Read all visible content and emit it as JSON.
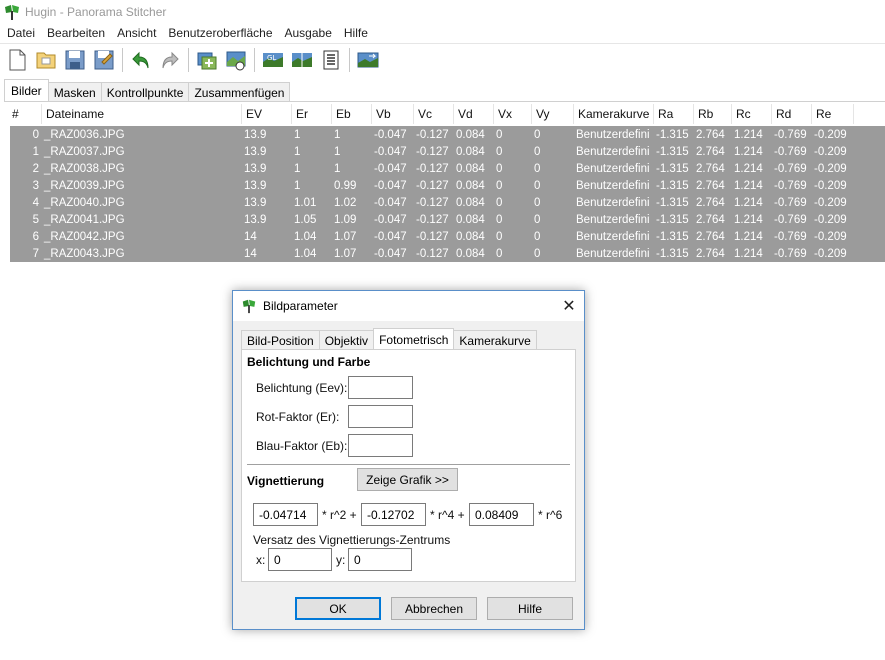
{
  "window": {
    "title": "Hugin - Panorama Stitcher"
  },
  "menu": [
    "Datei",
    "Bearbeiten",
    "Ansicht",
    "Benutzeroberfläche",
    "Ausgabe",
    "Hilfe"
  ],
  "toolbar": [
    "new-icon",
    "open-icon",
    "save-icon",
    "save-as-icon",
    "undo-icon",
    "redo-icon",
    "add-images-icon",
    "add-time-series-icon",
    "gl-preview-icon",
    "fast-preview-icon",
    "control-points-icon",
    "optimize-icon"
  ],
  "tabs": [
    "Bilder",
    "Masken",
    "Kontrollpunkte",
    "Zusammenfügen"
  ],
  "table": {
    "headers": [
      "#",
      "Dateiname",
      "EV",
      "Er",
      "Eb",
      "Vb",
      "Vc",
      "Vd",
      "Vx",
      "Vy",
      "Kamerakurve",
      "Ra",
      "Rb",
      "Rc",
      "Rd",
      "Re"
    ],
    "rows": [
      [
        "0",
        "_RAZ0036.JPG",
        "13.9",
        "1",
        "1",
        "-0.047",
        "-0.127",
        "0.084",
        "0",
        "0",
        "Benutzerdefini",
        "-1.315",
        "2.764",
        "1.214",
        "-0.769",
        "-0.209"
      ],
      [
        "1",
        "_RAZ0037.JPG",
        "13.9",
        "1",
        "1",
        "-0.047",
        "-0.127",
        "0.084",
        "0",
        "0",
        "Benutzerdefini",
        "-1.315",
        "2.764",
        "1.214",
        "-0.769",
        "-0.209"
      ],
      [
        "2",
        "_RAZ0038.JPG",
        "13.9",
        "1",
        "1",
        "-0.047",
        "-0.127",
        "0.084",
        "0",
        "0",
        "Benutzerdefini",
        "-1.315",
        "2.764",
        "1.214",
        "-0.769",
        "-0.209"
      ],
      [
        "3",
        "_RAZ0039.JPG",
        "13.9",
        "1",
        "0.99",
        "-0.047",
        "-0.127",
        "0.084",
        "0",
        "0",
        "Benutzerdefini",
        "-1.315",
        "2.764",
        "1.214",
        "-0.769",
        "-0.209"
      ],
      [
        "4",
        "_RAZ0040.JPG",
        "13.9",
        "1.01",
        "1.02",
        "-0.047",
        "-0.127",
        "0.084",
        "0",
        "0",
        "Benutzerdefini",
        "-1.315",
        "2.764",
        "1.214",
        "-0.769",
        "-0.209"
      ],
      [
        "5",
        "_RAZ0041.JPG",
        "13.9",
        "1.05",
        "1.09",
        "-0.047",
        "-0.127",
        "0.084",
        "0",
        "0",
        "Benutzerdefini",
        "-1.315",
        "2.764",
        "1.214",
        "-0.769",
        "-0.209"
      ],
      [
        "6",
        "_RAZ0042.JPG",
        "14",
        "1.04",
        "1.07",
        "-0.047",
        "-0.127",
        "0.084",
        "0",
        "0",
        "Benutzerdefini",
        "-1.315",
        "2.764",
        "1.214",
        "-0.769",
        "-0.209"
      ],
      [
        "7",
        "_RAZ0043.JPG",
        "14",
        "1.04",
        "1.07",
        "-0.047",
        "-0.127",
        "0.084",
        "0",
        "0",
        "Benutzerdefini",
        "-1.315",
        "2.764",
        "1.214",
        "-0.769",
        "-0.209"
      ]
    ]
  },
  "dialog": {
    "title": "Bildparameter",
    "close": "✕",
    "tabs": [
      "Bild-Position",
      "Objektiv",
      "Fotometrisch",
      "Kamerakurve"
    ],
    "section_exposure": "Belichtung und Farbe",
    "exposure_label": "Belichtung (Eev):",
    "exposure_value": "",
    "red_label": "Rot-Faktor (Er):",
    "red_value": "",
    "blue_label": "Blau-Faktor (Eb):",
    "blue_value": "",
    "section_vignetting": "Vignettierung",
    "show_graph": "Zeige Grafik >>",
    "vig_b": "-0.04714",
    "vig_b_suffix": "* r^2 +",
    "vig_c": "-0.12702",
    "vig_c_suffix": "* r^4 +",
    "vig_d": "0.08409",
    "vig_d_suffix": "* r^6",
    "offset_label": "Versatz des Vignettierungs-Zentrums",
    "x_label": "x:",
    "x_value": "0",
    "y_label": "y:",
    "y_value": "0",
    "ok": "OK",
    "cancel": "Abbrechen",
    "help": "Hilfe"
  }
}
